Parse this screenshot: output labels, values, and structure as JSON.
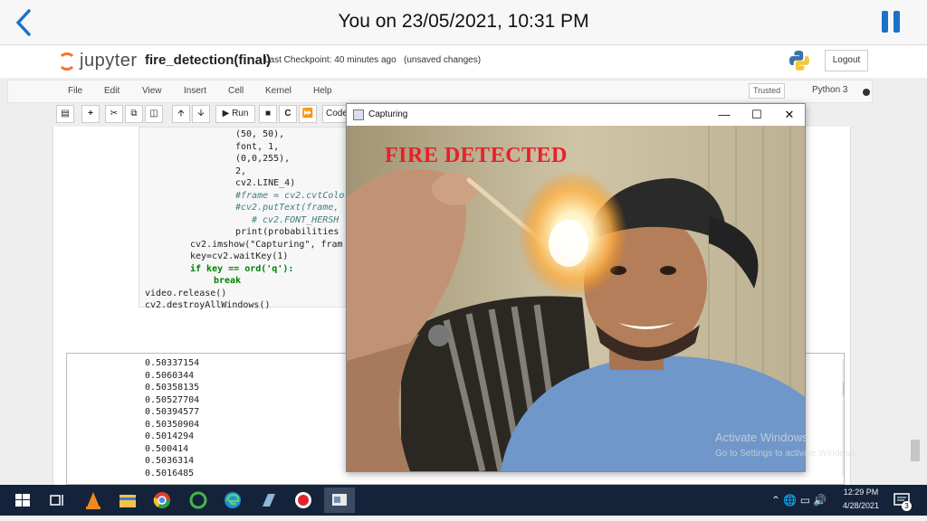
{
  "phone": {
    "title": "You on 23/05/2021, 10:31 PM",
    "accent": "#1a73c8"
  },
  "jupyter": {
    "logo_text": "jupyter",
    "notebook_name": "fire_detection(final)",
    "checkpoint": "Last Checkpoint: 40 minutes ago",
    "save_state": "(unsaved changes)",
    "logout": "Logout",
    "menu": [
      "File",
      "Edit",
      "View",
      "Insert",
      "Cell",
      "Kernel",
      "Help"
    ],
    "trusted": "Trusted",
    "kernel": "Python 3",
    "run_label": "Run",
    "cell_type": "Code"
  },
  "code_lines": [
    {
      "text": "(50, 50),",
      "indent": 100
    },
    {
      "text": "font, 1,",
      "indent": 100
    },
    {
      "text": "(0,0,255),",
      "indent": 100
    },
    {
      "text": "2,",
      "indent": 100
    },
    {
      "text": "cv2.LINE_4)",
      "indent": 100
    },
    {
      "text": "#frame = cv2.cvtColo",
      "indent": 100
    },
    {
      "text": "#cv2.putText(frame,",
      "indent": 100
    },
    {
      "text": "# cv2.FONT_HERSH",
      "indent": 118
    },
    {
      "text": "print(probabilities",
      "indent": 100
    },
    {
      "text": "cv2.imshow(\"Capturing\", fram",
      "indent": 50
    },
    {
      "text": "key=cv2.waitKey(1)",
      "indent": 50
    },
    {
      "text": "if key == ord('q'):",
      "indent": 50
    },
    {
      "text": "break",
      "indent": 76
    },
    {
      "text": "video.release()",
      "indent": 0
    },
    {
      "text": "cv2.destroyAllWindows()",
      "indent": 0
    }
  ],
  "output_lines": [
    "0.50337154",
    "0.5060344",
    "0.50358135",
    "0.50527704",
    "0.50394577",
    "0.50350904",
    "0.5014294",
    "0.500414",
    "0.5036314",
    "0.5016485"
  ],
  "capture_window": {
    "title": "Capturing",
    "overlay_text": "FIRE DETECTED",
    "minimize": "—",
    "maximize": "☐",
    "close": "✕"
  },
  "watermark": {
    "line1": "Activate Windows",
    "line2": "Go to Settings to activate Windows."
  },
  "taskbar": {
    "time": "12:29 PM",
    "date": "4/28/2021",
    "notification_count": "3"
  }
}
